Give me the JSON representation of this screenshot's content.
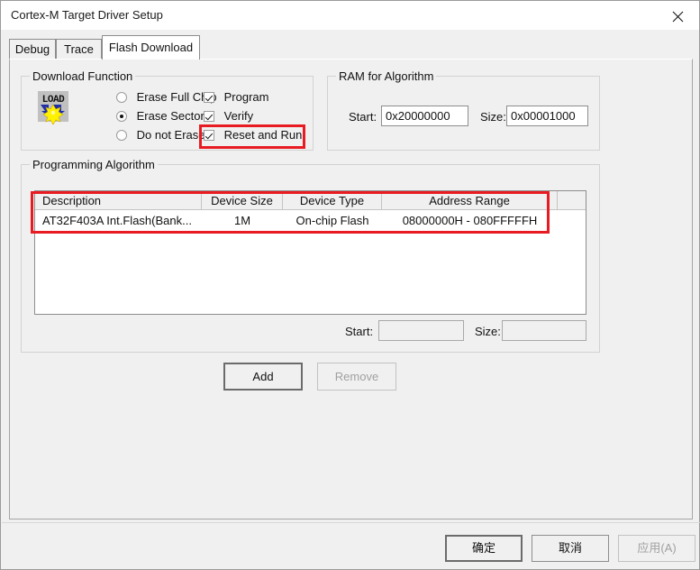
{
  "window": {
    "title": "Cortex-M Target Driver Setup",
    "close_icon": "close-icon"
  },
  "tabs": [
    {
      "label": "Debug",
      "active": false
    },
    {
      "label": "Trace",
      "active": false
    },
    {
      "label": "Flash Download",
      "active": true
    }
  ],
  "download_function": {
    "title": "Download Function",
    "icon": "load-icon",
    "icon_text": "LOAD",
    "radios": [
      {
        "label": "Erase Full Chip",
        "checked": false
      },
      {
        "label": "Erase Sectors",
        "checked": true
      },
      {
        "label": "Do not Erase",
        "checked": false
      }
    ],
    "checkboxes": [
      {
        "label": "Program",
        "checked": true
      },
      {
        "label": "Verify",
        "checked": true
      },
      {
        "label": "Reset and Run",
        "checked": true
      }
    ]
  },
  "ram_for_algorithm": {
    "title": "RAM for Algorithm",
    "start_label": "Start:",
    "start_value": "0x20000000",
    "size_label": "Size:",
    "size_value": "0x00001000"
  },
  "programming_algorithm": {
    "title": "Programming Algorithm",
    "columns": [
      "Description",
      "Device Size",
      "Device Type",
      "Address Range",
      ""
    ],
    "rows": [
      {
        "description": "AT32F403A Int.Flash(Bank...",
        "device_size": "1M",
        "device_type": "On-chip Flash",
        "address_range": "08000000H - 080FFFFFH"
      }
    ],
    "start_label": "Start:",
    "start_value": "",
    "size_label": "Size:",
    "size_value": "",
    "add_label": "Add",
    "remove_label": "Remove"
  },
  "footer": {
    "ok_label": "确定",
    "cancel_label": "取消",
    "apply_label": "应用(A)"
  },
  "colors": {
    "annotation": "#e81b23",
    "dialog_background": "#f0f0f0",
    "icon_blue": "#1f2fa8",
    "icon_yellow": "#fff200"
  }
}
